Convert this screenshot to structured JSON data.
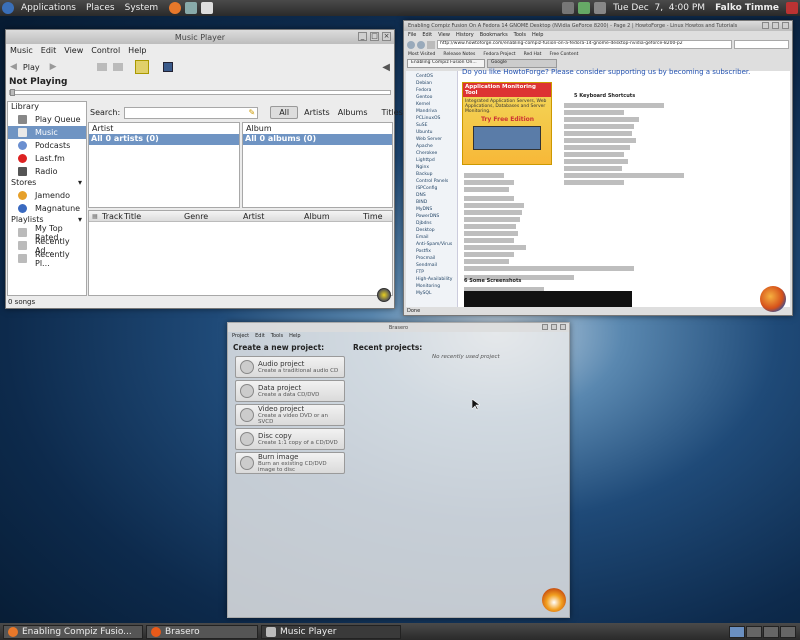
{
  "top_panel": {
    "menus": [
      "Applications",
      "Places",
      "System"
    ],
    "clock": "Tue Dec  7,  4:00 PM",
    "user": "Falko Timme"
  },
  "music_player": {
    "title": "Music Player",
    "menu": [
      "Music",
      "Edit",
      "View",
      "Control",
      "Help"
    ],
    "toolbar": {
      "play": "Play"
    },
    "status": "Not Playing",
    "library_label": "Library",
    "library_items": [
      "Play Queue",
      "Music",
      "Podcasts",
      "Last.fm",
      "Radio"
    ],
    "stores_label": "Stores",
    "stores_items": [
      "Jamendo",
      "Magnatune"
    ],
    "playlists_label": "Playlists",
    "playlist_items": [
      "My Top Rated",
      "Recently Ad...",
      "Recently Pl..."
    ],
    "search_label": "Search:",
    "filters": [
      "All",
      "Artists",
      "Albums",
      "Titles"
    ],
    "artist_header": "Artist",
    "artist_all": "All 0 artists (0)",
    "album_header": "Album",
    "album_all": "All 0 albums (0)",
    "track_cols": [
      "Track",
      "Title",
      "Genre",
      "Artist",
      "Album",
      "Time"
    ],
    "footer": "0 songs"
  },
  "firefox": {
    "title": "Enabling Compiz Fusion On A Fedora 14 GNOME Desktop (NVidia GeForce 8200) - Page 2 | HowtoForge - Linux Howtos and Tutorials - Mozilla Firefox",
    "menu": [
      "File",
      "Edit",
      "View",
      "History",
      "Bookmarks",
      "Tools",
      "Help"
    ],
    "url": "http://www.howtoforge.com/enabling-compiz-fusion-on-a-fedora-14-gnome-desktop-nvidia-geforce-8200-p2",
    "bookmarks": [
      "Most Visited",
      "Release Notes",
      "Fedora Project",
      "Red Hat",
      "Free Content"
    ],
    "tabs": [
      "Enabling Compiz Fusion On...",
      "Google"
    ],
    "banner": "Do you like HowtoForge? Please consider supporting us by becoming a subscriber.",
    "ad": {
      "title": "Application Monitoring Tool",
      "sub": "Integrated Application Servers, Web Applications, Databases and Server Monitoring.",
      "cta": "Try Free Edition"
    },
    "section1": "5 Keyboard Shortcuts",
    "section2": "6 Some Screenshots",
    "sidebar": [
      "CentOS",
      "Debian",
      "Fedora",
      "Gentoo",
      "Kernel",
      "Mandriva",
      "PCLinuxOS",
      "SuSE",
      "Ubuntu",
      "Web Server",
      "Apache",
      "Cherokee",
      "Lighttpd",
      "Nginx",
      "Backup",
      "Control Panels",
      "ISPConfig",
      "DNS",
      "BIND",
      "MyDNS",
      "PowerDNS",
      "Djbdns",
      "Desktop",
      "Email",
      "Anti-Spam/Virus",
      "Postfix",
      "Procmail",
      "Sendmail",
      "FTP",
      "High-Availability",
      "Monitoring",
      "MySQL"
    ],
    "status": "Done"
  },
  "brasero": {
    "title": "Brasero",
    "menu": [
      "Project",
      "Edit",
      "Tools",
      "Help"
    ],
    "create_label": "Create a new project:",
    "recent_label": "Recent projects:",
    "no_recent": "No recently used project",
    "projects": [
      {
        "name": "Audio project",
        "desc": "Create a traditional audio CD"
      },
      {
        "name": "Data project",
        "desc": "Create a data CD/DVD"
      },
      {
        "name": "Video project",
        "desc": "Create a video DVD or an SVCD"
      },
      {
        "name": "Disc copy",
        "desc": "Create 1:1 copy of a CD/DVD"
      },
      {
        "name": "Burn image",
        "desc": "Burn an existing CD/DVD image to disc"
      }
    ]
  },
  "taskbar": [
    "Enabling Compiz Fusio...",
    "Brasero",
    "Music Player"
  ]
}
